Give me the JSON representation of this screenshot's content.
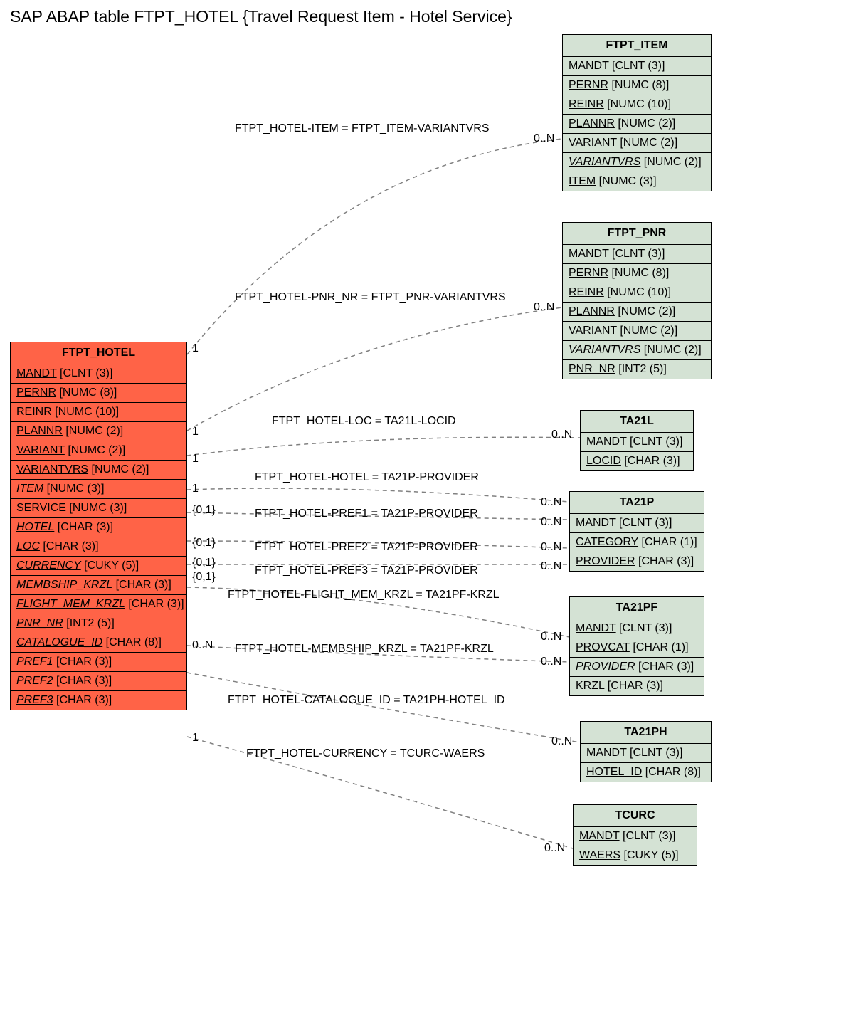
{
  "title": "SAP ABAP table FTPT_HOTEL {Travel Request Item - Hotel Service}",
  "main": {
    "name": "FTPT_HOTEL",
    "fields": [
      {
        "name": "MANDT",
        "type": "[CLNT (3)]",
        "italic": false
      },
      {
        "name": "PERNR",
        "type": "[NUMC (8)]",
        "italic": false
      },
      {
        "name": "REINR",
        "type": "[NUMC (10)]",
        "italic": false
      },
      {
        "name": "PLANNR",
        "type": "[NUMC (2)]",
        "italic": false
      },
      {
        "name": "VARIANT",
        "type": "[NUMC (2)]",
        "italic": false
      },
      {
        "name": "VARIANTVRS",
        "type": "[NUMC (2)]",
        "italic": false
      },
      {
        "name": "ITEM",
        "type": "[NUMC (3)]",
        "italic": true
      },
      {
        "name": "SERVICE",
        "type": "[NUMC (3)]",
        "italic": false
      },
      {
        "name": "HOTEL",
        "type": "[CHAR (3)]",
        "italic": true
      },
      {
        "name": "LOC",
        "type": "[CHAR (3)]",
        "italic": true
      },
      {
        "name": "CURRENCY",
        "type": "[CUKY (5)]",
        "italic": true
      },
      {
        "name": "MEMBSHIP_KRZL",
        "type": "[CHAR (3)]",
        "italic": true
      },
      {
        "name": "FLIGHT_MEM_KRZL",
        "type": "[CHAR (3)]",
        "italic": true
      },
      {
        "name": "PNR_NR",
        "type": "[INT2 (5)]",
        "italic": true
      },
      {
        "name": "CATALOGUE_ID",
        "type": "[CHAR (8)]",
        "italic": true
      },
      {
        "name": "PREF1",
        "type": "[CHAR (3)]",
        "italic": true
      },
      {
        "name": "PREF2",
        "type": "[CHAR (3)]",
        "italic": true
      },
      {
        "name": "PREF3",
        "type": "[CHAR (3)]",
        "italic": true
      }
    ]
  },
  "related": [
    {
      "id": "ftpt_item",
      "name": "FTPT_ITEM",
      "fields": [
        {
          "name": "MANDT",
          "type": "[CLNT (3)]",
          "italic": false
        },
        {
          "name": "PERNR",
          "type": "[NUMC (8)]",
          "italic": false
        },
        {
          "name": "REINR",
          "type": "[NUMC (10)]",
          "italic": false
        },
        {
          "name": "PLANNR",
          "type": "[NUMC (2)]",
          "italic": false
        },
        {
          "name": "VARIANT",
          "type": "[NUMC (2)]",
          "italic": false
        },
        {
          "name": "VARIANTVRS",
          "type": "[NUMC (2)]",
          "italic": true
        },
        {
          "name": "ITEM",
          "type": "[NUMC (3)]",
          "italic": false
        }
      ]
    },
    {
      "id": "ftpt_pnr",
      "name": "FTPT_PNR",
      "fields": [
        {
          "name": "MANDT",
          "type": "[CLNT (3)]",
          "italic": false
        },
        {
          "name": "PERNR",
          "type": "[NUMC (8)]",
          "italic": false
        },
        {
          "name": "REINR",
          "type": "[NUMC (10)]",
          "italic": false
        },
        {
          "name": "PLANNR",
          "type": "[NUMC (2)]",
          "italic": false
        },
        {
          "name": "VARIANT",
          "type": "[NUMC (2)]",
          "italic": false
        },
        {
          "name": "VARIANTVRS",
          "type": "[NUMC (2)]",
          "italic": true
        },
        {
          "name": "PNR_NR",
          "type": "[INT2 (5)]",
          "italic": false
        }
      ]
    },
    {
      "id": "ta21l",
      "name": "TA21L",
      "fields": [
        {
          "name": "MANDT",
          "type": "[CLNT (3)]",
          "italic": false
        },
        {
          "name": "LOCID",
          "type": "[CHAR (3)]",
          "italic": false
        }
      ]
    },
    {
      "id": "ta21p",
      "name": "TA21P",
      "fields": [
        {
          "name": "MANDT",
          "type": "[CLNT (3)]",
          "italic": false
        },
        {
          "name": "CATEGORY",
          "type": "[CHAR (1)]",
          "italic": false
        },
        {
          "name": "PROVIDER",
          "type": "[CHAR (3)]",
          "italic": false
        }
      ]
    },
    {
      "id": "ta21pf",
      "name": "TA21PF",
      "fields": [
        {
          "name": "MANDT",
          "type": "[CLNT (3)]",
          "italic": false
        },
        {
          "name": "PROVCAT",
          "type": "[CHAR (1)]",
          "italic": false
        },
        {
          "name": "PROVIDER",
          "type": "[CHAR (3)]",
          "italic": true
        },
        {
          "name": "KRZL",
          "type": "[CHAR (3)]",
          "italic": false
        }
      ]
    },
    {
      "id": "ta21ph",
      "name": "TA21PH",
      "fields": [
        {
          "name": "MANDT",
          "type": "[CLNT (3)]",
          "italic": false
        },
        {
          "name": "HOTEL_ID",
          "type": "[CHAR (8)]",
          "italic": false
        }
      ]
    },
    {
      "id": "tcurc",
      "name": "TCURC",
      "fields": [
        {
          "name": "MANDT",
          "type": "[CLNT (3)]",
          "italic": false
        },
        {
          "name": "WAERS",
          "type": "[CUKY (5)]",
          "italic": false
        }
      ]
    }
  ],
  "relations": [
    {
      "label": "FTPT_HOTEL-ITEM = FTPT_ITEM-VARIANTVRS",
      "left_card": "1",
      "right_card": "0..N"
    },
    {
      "label": "FTPT_HOTEL-PNR_NR = FTPT_PNR-VARIANTVRS",
      "left_card": "1",
      "right_card": "0..N"
    },
    {
      "label": "FTPT_HOTEL-LOC = TA21L-LOCID",
      "left_card": "1",
      "right_card": "0..N"
    },
    {
      "label": "FTPT_HOTEL-HOTEL = TA21P-PROVIDER",
      "left_card": "1",
      "right_card": "0..N"
    },
    {
      "label": "FTPT_HOTEL-PREF1 = TA21P-PROVIDER",
      "left_card": "{0,1}",
      "right_card": "0..N"
    },
    {
      "label": "FTPT_HOTEL-PREF2 = TA21P-PROVIDER",
      "left_card": "{0,1}",
      "right_card": "0..N"
    },
    {
      "label": "FTPT_HOTEL-PREF3 = TA21P-PROVIDER",
      "left_card": "{0,1}",
      "right_card": "0..N"
    },
    {
      "label": "FTPT_HOTEL-FLIGHT_MEM_KRZL = TA21PF-KRZL",
      "left_card": "{0,1}",
      "right_card": "0..N"
    },
    {
      "label": "FTPT_HOTEL-MEMBSHIP_KRZL = TA21PF-KRZL",
      "left_card": "0..N",
      "right_card": "0..N"
    },
    {
      "label": "FTPT_HOTEL-CATALOGUE_ID = TA21PH-HOTEL_ID",
      "left_card": "",
      "right_card": "0..N"
    },
    {
      "label": "FTPT_HOTEL-CURRENCY = TCURC-WAERS",
      "left_card": "1",
      "right_card": "0..N"
    }
  ]
}
